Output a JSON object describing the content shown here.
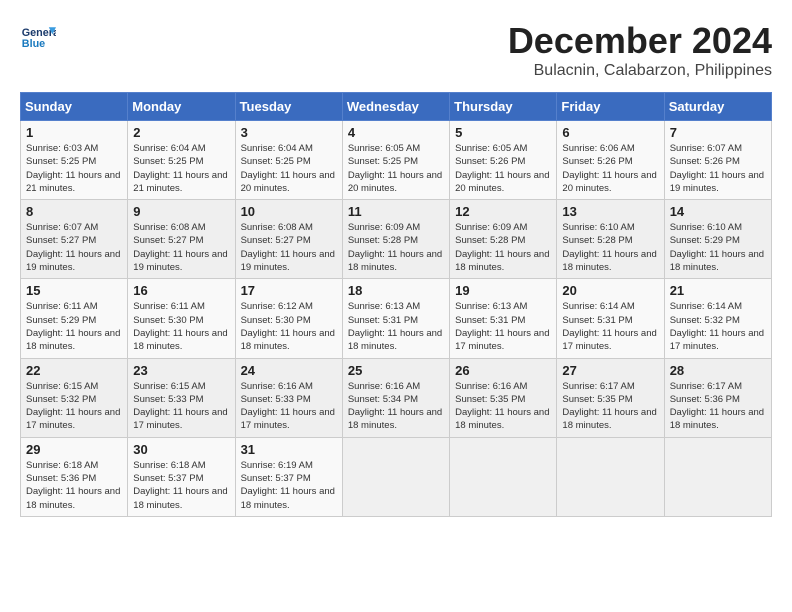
{
  "header": {
    "logo_line1": "General",
    "logo_line2": "Blue",
    "title": "December 2024",
    "subtitle": "Bulacnin, Calabarzon, Philippines"
  },
  "weekdays": [
    "Sunday",
    "Monday",
    "Tuesday",
    "Wednesday",
    "Thursday",
    "Friday",
    "Saturday"
  ],
  "weeks": [
    [
      {
        "day": "1",
        "sunrise": "Sunrise: 6:03 AM",
        "sunset": "Sunset: 5:25 PM",
        "daylight": "Daylight: 11 hours and 21 minutes."
      },
      {
        "day": "2",
        "sunrise": "Sunrise: 6:04 AM",
        "sunset": "Sunset: 5:25 PM",
        "daylight": "Daylight: 11 hours and 21 minutes."
      },
      {
        "day": "3",
        "sunrise": "Sunrise: 6:04 AM",
        "sunset": "Sunset: 5:25 PM",
        "daylight": "Daylight: 11 hours and 20 minutes."
      },
      {
        "day": "4",
        "sunrise": "Sunrise: 6:05 AM",
        "sunset": "Sunset: 5:25 PM",
        "daylight": "Daylight: 11 hours and 20 minutes."
      },
      {
        "day": "5",
        "sunrise": "Sunrise: 6:05 AM",
        "sunset": "Sunset: 5:26 PM",
        "daylight": "Daylight: 11 hours and 20 minutes."
      },
      {
        "day": "6",
        "sunrise": "Sunrise: 6:06 AM",
        "sunset": "Sunset: 5:26 PM",
        "daylight": "Daylight: 11 hours and 20 minutes."
      },
      {
        "day": "7",
        "sunrise": "Sunrise: 6:07 AM",
        "sunset": "Sunset: 5:26 PM",
        "daylight": "Daylight: 11 hours and 19 minutes."
      }
    ],
    [
      {
        "day": "8",
        "sunrise": "Sunrise: 6:07 AM",
        "sunset": "Sunset: 5:27 PM",
        "daylight": "Daylight: 11 hours and 19 minutes."
      },
      {
        "day": "9",
        "sunrise": "Sunrise: 6:08 AM",
        "sunset": "Sunset: 5:27 PM",
        "daylight": "Daylight: 11 hours and 19 minutes."
      },
      {
        "day": "10",
        "sunrise": "Sunrise: 6:08 AM",
        "sunset": "Sunset: 5:27 PM",
        "daylight": "Daylight: 11 hours and 19 minutes."
      },
      {
        "day": "11",
        "sunrise": "Sunrise: 6:09 AM",
        "sunset": "Sunset: 5:28 PM",
        "daylight": "Daylight: 11 hours and 18 minutes."
      },
      {
        "day": "12",
        "sunrise": "Sunrise: 6:09 AM",
        "sunset": "Sunset: 5:28 PM",
        "daylight": "Daylight: 11 hours and 18 minutes."
      },
      {
        "day": "13",
        "sunrise": "Sunrise: 6:10 AM",
        "sunset": "Sunset: 5:28 PM",
        "daylight": "Daylight: 11 hours and 18 minutes."
      },
      {
        "day": "14",
        "sunrise": "Sunrise: 6:10 AM",
        "sunset": "Sunset: 5:29 PM",
        "daylight": "Daylight: 11 hours and 18 minutes."
      }
    ],
    [
      {
        "day": "15",
        "sunrise": "Sunrise: 6:11 AM",
        "sunset": "Sunset: 5:29 PM",
        "daylight": "Daylight: 11 hours and 18 minutes."
      },
      {
        "day": "16",
        "sunrise": "Sunrise: 6:11 AM",
        "sunset": "Sunset: 5:30 PM",
        "daylight": "Daylight: 11 hours and 18 minutes."
      },
      {
        "day": "17",
        "sunrise": "Sunrise: 6:12 AM",
        "sunset": "Sunset: 5:30 PM",
        "daylight": "Daylight: 11 hours and 18 minutes."
      },
      {
        "day": "18",
        "sunrise": "Sunrise: 6:13 AM",
        "sunset": "Sunset: 5:31 PM",
        "daylight": "Daylight: 11 hours and 18 minutes."
      },
      {
        "day": "19",
        "sunrise": "Sunrise: 6:13 AM",
        "sunset": "Sunset: 5:31 PM",
        "daylight": "Daylight: 11 hours and 17 minutes."
      },
      {
        "day": "20",
        "sunrise": "Sunrise: 6:14 AM",
        "sunset": "Sunset: 5:31 PM",
        "daylight": "Daylight: 11 hours and 17 minutes."
      },
      {
        "day": "21",
        "sunrise": "Sunrise: 6:14 AM",
        "sunset": "Sunset: 5:32 PM",
        "daylight": "Daylight: 11 hours and 17 minutes."
      }
    ],
    [
      {
        "day": "22",
        "sunrise": "Sunrise: 6:15 AM",
        "sunset": "Sunset: 5:32 PM",
        "daylight": "Daylight: 11 hours and 17 minutes."
      },
      {
        "day": "23",
        "sunrise": "Sunrise: 6:15 AM",
        "sunset": "Sunset: 5:33 PM",
        "daylight": "Daylight: 11 hours and 17 minutes."
      },
      {
        "day": "24",
        "sunrise": "Sunrise: 6:16 AM",
        "sunset": "Sunset: 5:33 PM",
        "daylight": "Daylight: 11 hours and 17 minutes."
      },
      {
        "day": "25",
        "sunrise": "Sunrise: 6:16 AM",
        "sunset": "Sunset: 5:34 PM",
        "daylight": "Daylight: 11 hours and 18 minutes."
      },
      {
        "day": "26",
        "sunrise": "Sunrise: 6:16 AM",
        "sunset": "Sunset: 5:35 PM",
        "daylight": "Daylight: 11 hours and 18 minutes."
      },
      {
        "day": "27",
        "sunrise": "Sunrise: 6:17 AM",
        "sunset": "Sunset: 5:35 PM",
        "daylight": "Daylight: 11 hours and 18 minutes."
      },
      {
        "day": "28",
        "sunrise": "Sunrise: 6:17 AM",
        "sunset": "Sunset: 5:36 PM",
        "daylight": "Daylight: 11 hours and 18 minutes."
      }
    ],
    [
      {
        "day": "29",
        "sunrise": "Sunrise: 6:18 AM",
        "sunset": "Sunset: 5:36 PM",
        "daylight": "Daylight: 11 hours and 18 minutes."
      },
      {
        "day": "30",
        "sunrise": "Sunrise: 6:18 AM",
        "sunset": "Sunset: 5:37 PM",
        "daylight": "Daylight: 11 hours and 18 minutes."
      },
      {
        "day": "31",
        "sunrise": "Sunrise: 6:19 AM",
        "sunset": "Sunset: 5:37 PM",
        "daylight": "Daylight: 11 hours and 18 minutes."
      },
      null,
      null,
      null,
      null
    ]
  ]
}
